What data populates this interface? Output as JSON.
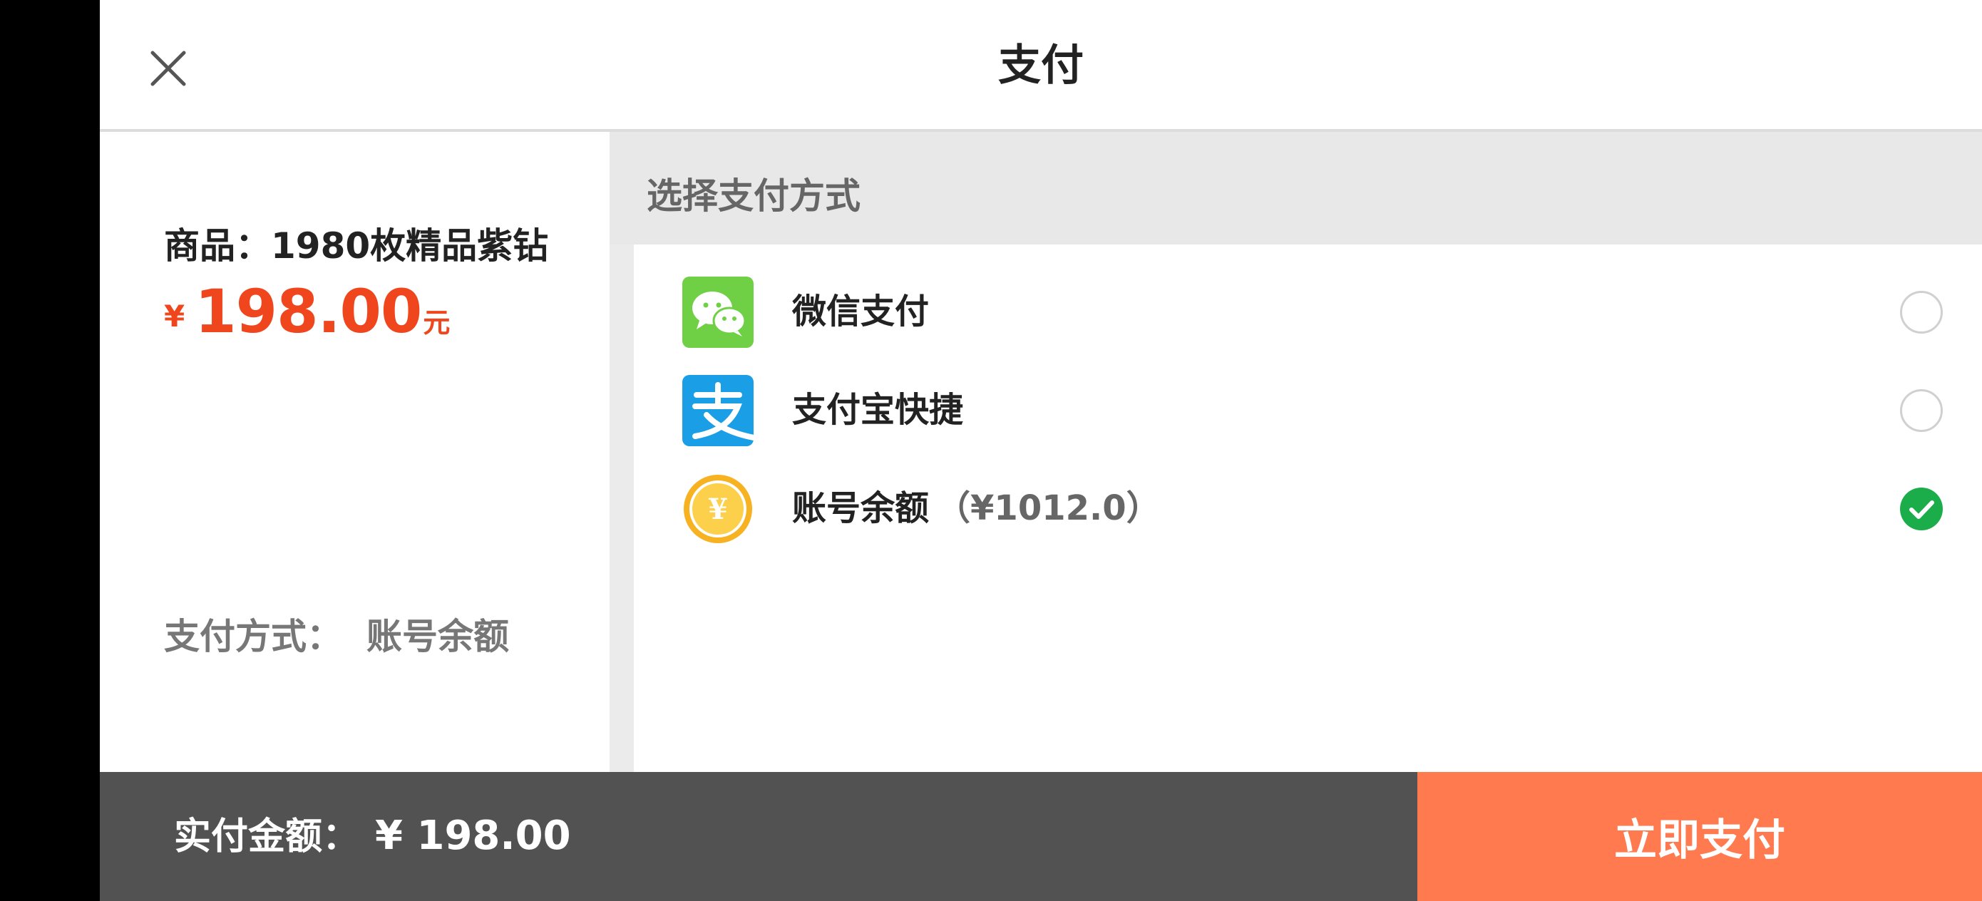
{
  "header": {
    "title": "支付",
    "close_icon": "close-icon"
  },
  "summary": {
    "product_label": "商品：",
    "product_name": "1980枚精品紫钻",
    "price_symbol": "¥",
    "price_value": "198.00",
    "price_unit": "元",
    "method_label": "支付方式：",
    "method_value": "账号余额"
  },
  "methods": {
    "heading": "选择支付方式",
    "options": [
      {
        "label": "微信支付",
        "extra": "",
        "icon": "wechat-pay-icon",
        "selected": false
      },
      {
        "label": "支付宝快捷",
        "extra": "",
        "icon": "alipay-icon",
        "selected": false
      },
      {
        "label": "账号余额",
        "extra": "（¥1012.0）",
        "icon": "coin-balance-icon",
        "selected": true
      }
    ]
  },
  "footer": {
    "total_label": "实付金额：",
    "total_amount": "¥ 198.00",
    "pay_button": "立即支付"
  },
  "colors": {
    "price": "#f0461e",
    "pay_button": "#ff7a4f",
    "footer_bg": "#525252",
    "selected": "#1aad4a",
    "wechat": "#6fd046",
    "alipay": "#1a9fe6",
    "coin": "#f6b221"
  }
}
